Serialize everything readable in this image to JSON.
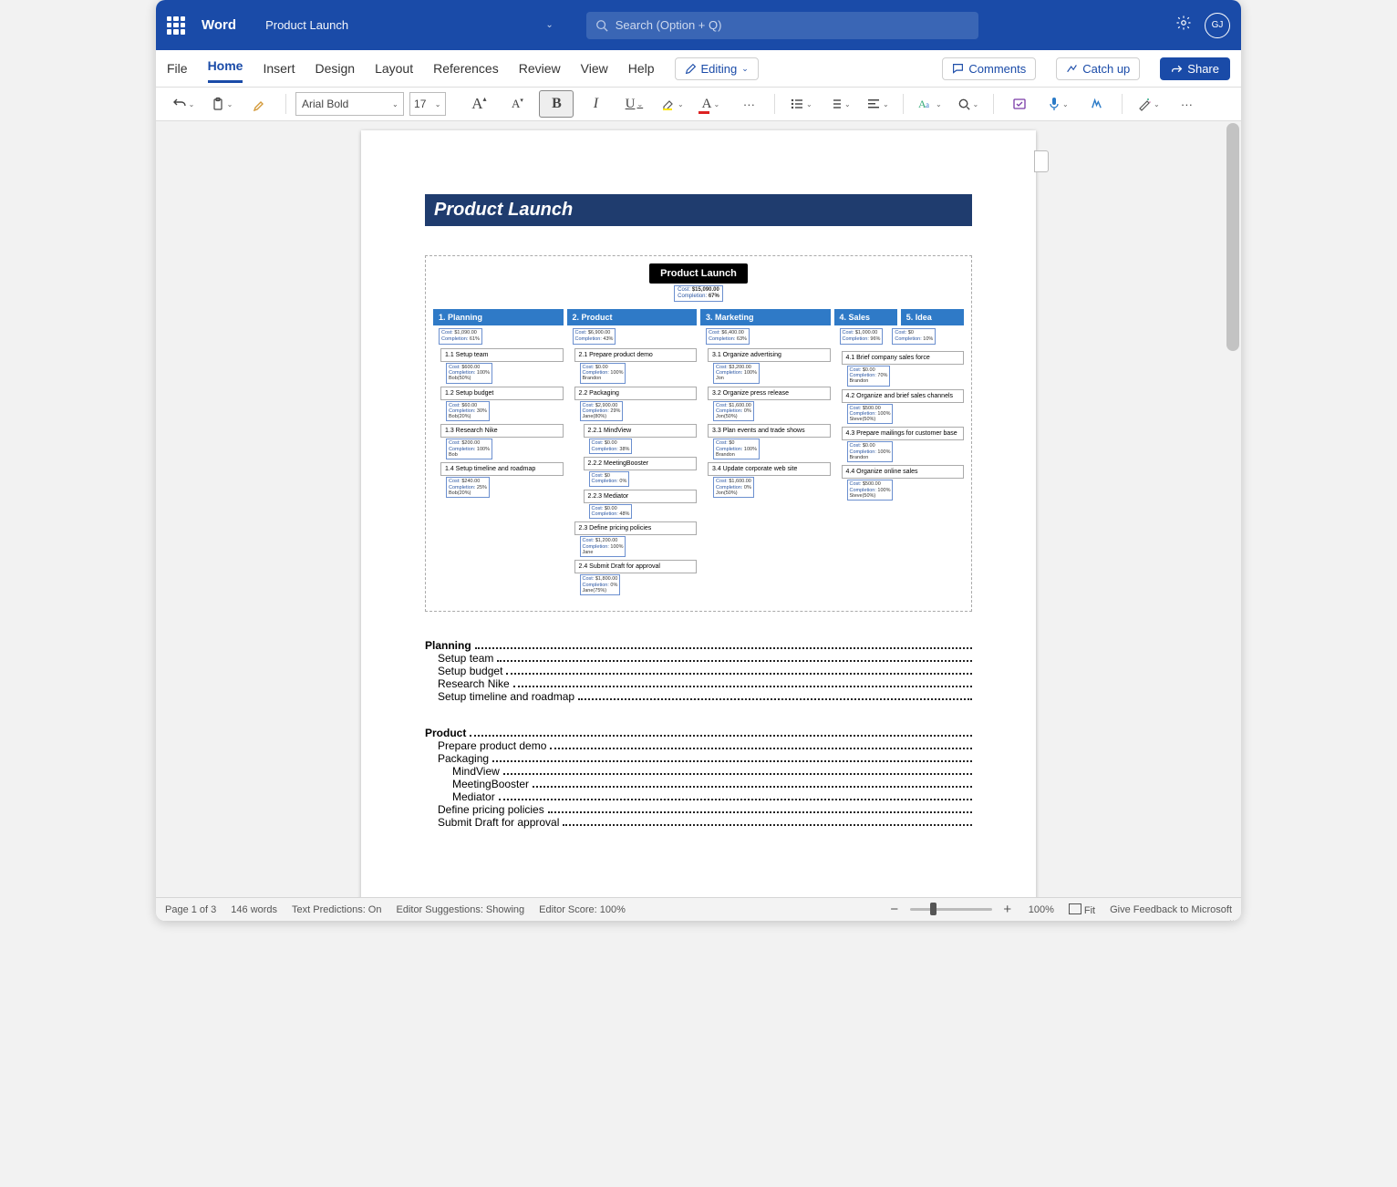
{
  "titlebar": {
    "app": "Word",
    "doc": "Product Launch",
    "search_placeholder": "Search (Option + Q)",
    "avatar": "GJ"
  },
  "menu": {
    "file": "File",
    "home": "Home",
    "insert": "Insert",
    "design": "Design",
    "layout": "Layout",
    "references": "References",
    "review": "Review",
    "view": "View",
    "help": "Help",
    "editing": "Editing",
    "comments": "Comments",
    "catchup": "Catch up",
    "share": "Share"
  },
  "ribbon": {
    "font_name": "Arial Bold",
    "font_size": "17"
  },
  "doc": {
    "title": "Product Launch",
    "diagram": {
      "root": {
        "label": "Product Launch",
        "cost": "$15,090.00",
        "completion": "67%"
      },
      "cols": [
        {
          "hd": "1.  Planning",
          "cost": "$1,090.00",
          "comp": "61%",
          "tasks": [
            {
              "n": "1.1",
              "t": "Setup team",
              "cost": "$600.00",
              "comp": "100%",
              "who": "Bob(50%)"
            },
            {
              "n": "1.2",
              "t": "Setup budget",
              "cost": "$60.00",
              "comp": "30%",
              "who": "Bob(20%)"
            },
            {
              "n": "1.3",
              "t": "Research Nike",
              "cost": "$200.00",
              "comp": "100%",
              "who": "Bob"
            },
            {
              "n": "1.4",
              "t": "Setup timeline and roadmap",
              "cost": "$240.00",
              "comp": "25%",
              "who": "Bob(20%)"
            }
          ]
        },
        {
          "hd": "2.  Product",
          "cost": "$6,900.00",
          "comp": "43%",
          "tasks": [
            {
              "n": "2.1",
              "t": "Prepare product demo",
              "cost": "$0.00",
              "comp": "100%",
              "who": "Brandon"
            },
            {
              "n": "2.2",
              "t": "Packaging",
              "cost": "$2,900.00",
              "comp": "29%",
              "who": "Jane(80%)",
              "subs": [
                {
                  "n": "2.2.1",
                  "t": "MindView",
                  "cost": "$0.00",
                  "comp": "38%"
                },
                {
                  "n": "2.2.2",
                  "t": "MeetingBooster",
                  "cost": "$0",
                  "comp": "0%"
                },
                {
                  "n": "2.2.3",
                  "t": "Mediator",
                  "cost": "$0.00",
                  "comp": "48%"
                }
              ]
            },
            {
              "n": "2.3",
              "t": "Define pricing policies",
              "cost": "$1,200.00",
              "comp": "100%",
              "who": "Jane"
            },
            {
              "n": "2.4",
              "t": "Submit Draft for approval",
              "cost": "$1,800.00",
              "comp": "0%",
              "who": "Jane(75%)"
            }
          ]
        },
        {
          "hd": "3.  Marketing",
          "cost": "$6,400.00",
          "comp": "63%",
          "tasks": [
            {
              "n": "3.1",
              "t": "Organize advertising",
              "cost": "$3,200.00",
              "comp": "100%",
              "who": "Jon"
            },
            {
              "n": "3.2",
              "t": "Organize press release",
              "cost": "$1,600.00",
              "comp": "0%",
              "who": "Jon(50%)"
            },
            {
              "n": "3.3",
              "t": "Plan events and trade shows",
              "cost": "$0",
              "comp": "100%",
              "who": "Brandon"
            },
            {
              "n": "3.4",
              "t": "Update corporate web site",
              "cost": "$1,600.00",
              "comp": "0%",
              "who": "Jon(50%)"
            }
          ]
        },
        {
          "hd": "4.  Sales",
          "cost": "$1,000.00",
          "comp": "96%",
          "hd2": "5.  Idea",
          "cost2": "$0",
          "comp2": "10%",
          "tasks": [
            {
              "n": "4.1",
              "t": "Brief company sales force",
              "cost": "$0.00",
              "comp": "70%",
              "who": "Brandon"
            },
            {
              "n": "4.2",
              "t": "Organize and brief sales channels",
              "cost": "$500.00",
              "comp": "100%",
              "who": "Steve(50%)"
            },
            {
              "n": "4.3",
              "t": "Prepare mailings for customer base",
              "cost": "$0.00",
              "comp": "100%",
              "who": "Brandon"
            },
            {
              "n": "4.4",
              "t": "Organize online sales",
              "cost": "$500.00",
              "comp": "100%",
              "who": "Steve(50%)"
            }
          ]
        }
      ]
    },
    "toc": [
      {
        "l": 0,
        "t": "Planning"
      },
      {
        "l": 1,
        "t": "Setup team"
      },
      {
        "l": 1,
        "t": "Setup budget"
      },
      {
        "l": 1,
        "t": "Research Nike"
      },
      {
        "l": 1,
        "t": "Setup timeline and roadmap"
      },
      {
        "l": 0,
        "t": "Product"
      },
      {
        "l": 1,
        "t": "Prepare product demo"
      },
      {
        "l": 1,
        "t": "Packaging"
      },
      {
        "l": 2,
        "t": "MindView"
      },
      {
        "l": 2,
        "t": "MeetingBooster"
      },
      {
        "l": 2,
        "t": "Mediator"
      },
      {
        "l": 1,
        "t": "Define pricing policies"
      },
      {
        "l": 1,
        "t": "Submit Draft for approval"
      }
    ]
  },
  "status": {
    "page": "Page 1 of 3",
    "words": "146 words",
    "pred": "Text Predictions: On",
    "sugg": "Editor Suggestions: Showing",
    "score": "Editor Score: 100%",
    "zoom": "100%",
    "fit": "Fit",
    "feedback": "Give Feedback to Microsoft"
  }
}
